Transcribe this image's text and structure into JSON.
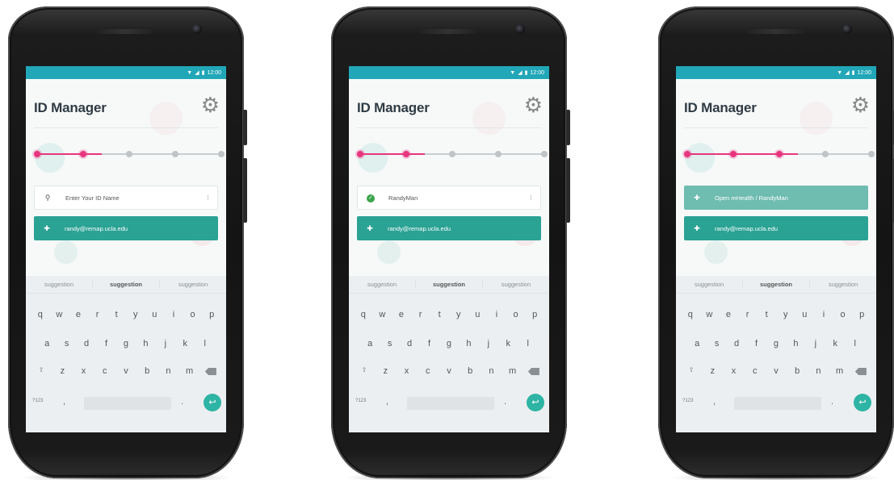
{
  "phones": [
    {
      "status_time": "12:00",
      "app_title": "ID Manager",
      "steps_done": 2,
      "steps_total": 5,
      "row1": {
        "style": "input",
        "icon": "search-icon",
        "text": "Enter Your ID Name",
        "trail": "mic-icon"
      },
      "row2": {
        "style": "green",
        "icon": "plus-icon",
        "text": "randy@remap.ucla.edu"
      }
    },
    {
      "status_time": "12:00",
      "app_title": "ID Manager",
      "steps_done": 2,
      "steps_total": 5,
      "row1": {
        "style": "input",
        "icon": "check-icon",
        "text": "RandyMan",
        "trail": "mic-icon"
      },
      "row2": {
        "style": "green",
        "icon": "plus-icon",
        "text": "randy@remap.ucla.edu"
      }
    },
    {
      "status_time": "12:00",
      "app_title": "ID Manager",
      "steps_done": 3,
      "steps_total": 5,
      "row1": {
        "style": "lightgreen",
        "icon": "plus-icon",
        "text": "Open mHealth / RandyMan"
      },
      "row2": {
        "style": "green",
        "icon": "plus-icon",
        "text": "randy@remap.ucla.edu"
      }
    }
  ],
  "keyboard": {
    "suggestions": [
      "suggestion",
      "suggestion",
      "suggestion"
    ],
    "row_q": [
      "q",
      "w",
      "e",
      "r",
      "t",
      "y",
      "u",
      "i",
      "o",
      "p"
    ],
    "row_a": [
      "a",
      "s",
      "d",
      "f",
      "g",
      "h",
      "j",
      "k",
      "l"
    ],
    "row_z": [
      "z",
      "x",
      "c",
      "v",
      "b",
      "n",
      "m"
    ],
    "sym_label": "?123",
    "comma": ",",
    "dot": "."
  },
  "colors": {
    "status_bar": "#21a7b8",
    "accent_pink": "#e8357f",
    "button_green": "#2aa294",
    "button_lightgreen": "#6fbcb1"
  }
}
